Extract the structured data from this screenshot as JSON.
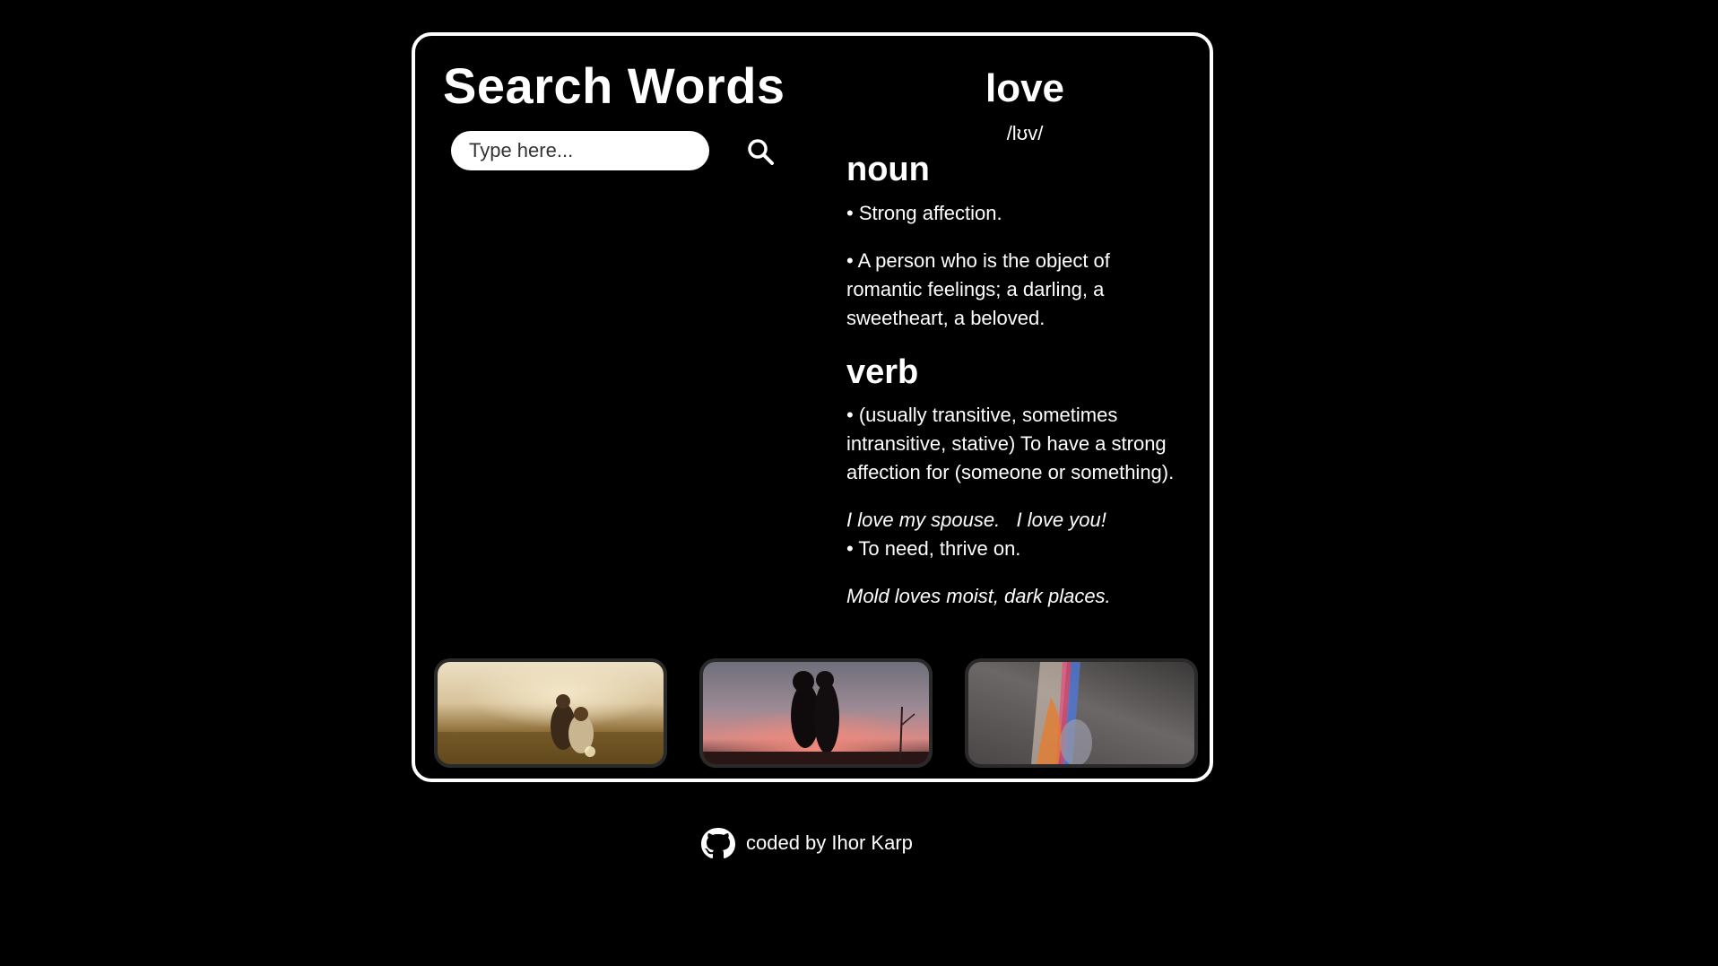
{
  "app": {
    "title": "Search Words"
  },
  "search": {
    "placeholder": "Type here...",
    "value": ""
  },
  "result": {
    "word": "love",
    "phonetic": "/lʊv/",
    "meanings": [
      {
        "part_of_speech": "noun",
        "definitions": [
          "• Strong affection.",
          "• A person who is the object of romantic feelings; a darling, a sweetheart, a beloved."
        ]
      },
      {
        "part_of_speech": "verb",
        "definitions": [
          "• (usually transitive, sometimes intransitive, stative) To have a strong affection for (someone or something).",
          "• To need, thrive on."
        ],
        "examples": [
          "I love my spouse.   I love you!",
          "Mold loves moist, dark places."
        ]
      }
    ]
  },
  "gallery": {
    "images": [
      {
        "name": "couple in golden field",
        "colors": [
          "#ece0c4",
          "#8a6a33"
        ]
      },
      {
        "name": "silhouetted couple kissing at sunset",
        "colors": [
          "#6e6f7a",
          "#d78a86"
        ]
      },
      {
        "name": "hands with rainbow light",
        "colors": [
          "#4a4646",
          "#e87a2a"
        ]
      }
    ]
  },
  "footer": {
    "text": "coded by Ihor Karp",
    "icon": "github-icon"
  },
  "colors": {
    "background": "#000000",
    "text": "#ffffff",
    "card_border": "#ffffff",
    "input_background": "#ffffff"
  }
}
